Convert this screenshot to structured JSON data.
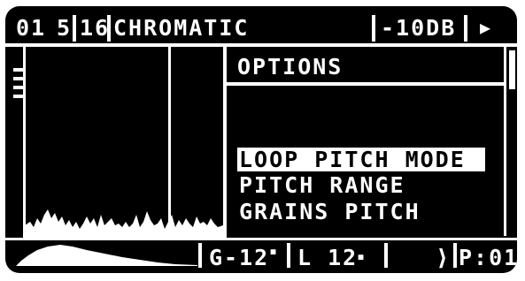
{
  "header": {
    "bank": "01",
    "slot": "5",
    "step": "16",
    "scale": "CHROMATIC",
    "level": "-10DB",
    "play_glyph": "▶"
  },
  "options": {
    "title": "OPTIONS",
    "items": [
      {
        "label": "LOOP PITCH MODE",
        "selected": true
      },
      {
        "label": "PITCH RANGE",
        "selected": false
      },
      {
        "label": "GRAINS PITCH",
        "selected": false
      }
    ]
  },
  "footer": {
    "gain": "G-12",
    "gain_mark": "▪",
    "loop": "L 12",
    "loop_mark": "▪",
    "arrow": "⟩",
    "preset": "P:01"
  },
  "colors": {
    "screen_bg": "#000000",
    "foreground": "#ffffff"
  },
  "icons": {
    "menu": "list-lines-icon",
    "play": "play-icon"
  }
}
